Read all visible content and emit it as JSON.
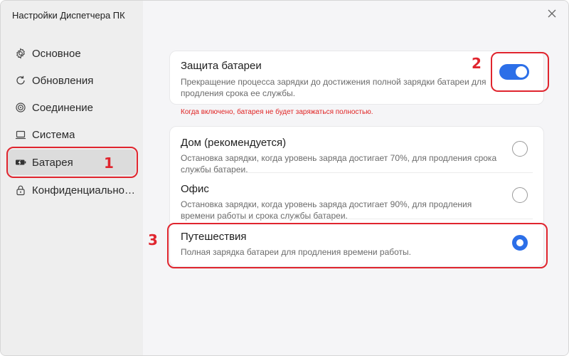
{
  "window": {
    "title": "Настройки Диспетчера ПК",
    "close_icon": "close-icon"
  },
  "sidebar": {
    "items": [
      {
        "label": "Основное",
        "icon": "gear-icon",
        "active": false
      },
      {
        "label": "Обновления",
        "icon": "refresh-icon",
        "active": false
      },
      {
        "label": "Соединение",
        "icon": "connection-icon",
        "active": false
      },
      {
        "label": "Система",
        "icon": "laptop-icon",
        "active": false
      },
      {
        "label": "Батарея",
        "icon": "battery-icon",
        "active": true
      },
      {
        "label": "Конфиденциально…",
        "icon": "lock-icon",
        "active": false
      }
    ]
  },
  "battery_protection": {
    "title": "Защита батареи",
    "description": "Прекращение процесса зарядки до достижения полной зарядки батареи для продления срока ее службы.",
    "enabled": true,
    "warning": "Когда включено, батарея не будет заряжаться полностью."
  },
  "modes": [
    {
      "title": "Дом (рекомендуется)",
      "description": "Остановка зарядки, когда уровень заряда достигает 70%, для продления срока службы батареи.",
      "selected": false
    },
    {
      "title": "Офис",
      "description": "Остановка зарядки, когда уровень заряда достигает 90%, для продления времени работы и срока службы батареи.",
      "selected": false
    },
    {
      "title": "Путешествия",
      "description": "Полная зарядка батареи для продления времени работы.",
      "selected": true
    }
  ],
  "annotations": {
    "one": "1",
    "two": "2",
    "three": "3"
  },
  "colors": {
    "accent": "#2c6fe8",
    "warning": "#e02424",
    "annotation": "#e0252e"
  }
}
